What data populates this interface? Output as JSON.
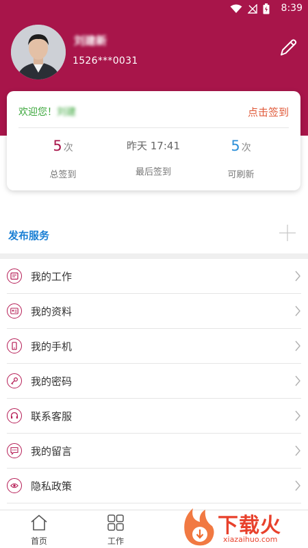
{
  "status_bar": {
    "time": "8:39"
  },
  "profile": {
    "name": "刘建新",
    "phone": "1526***0031"
  },
  "checkin_card": {
    "welcome": "欢迎您！",
    "welcome_name": "刘建",
    "signin_link": "点击签到",
    "total": {
      "value": "5",
      "unit": "次",
      "label": "总签到"
    },
    "last": {
      "value": "昨天 17:41",
      "label": "最后签到"
    },
    "refresh": {
      "value": "5",
      "unit": "次",
      "label": "可刷新"
    }
  },
  "publish": {
    "label": "发布服务"
  },
  "menu": {
    "items": [
      {
        "label": "我的工作",
        "icon": "briefcase-icon"
      },
      {
        "label": "我的资料",
        "icon": "profile-card-icon"
      },
      {
        "label": "我的手机",
        "icon": "phone-icon"
      },
      {
        "label": "我的密码",
        "icon": "key-icon"
      },
      {
        "label": "联系客服",
        "icon": "headset-icon"
      },
      {
        "label": "我的留言",
        "icon": "message-icon"
      },
      {
        "label": "隐私政策",
        "icon": "eye-icon"
      }
    ]
  },
  "bottom_nav": {
    "home": "首页",
    "work": "工作"
  },
  "watermark": {
    "text": "下载火",
    "sub": "xiazaihuo.com"
  },
  "colors": {
    "brand": "#a8154a",
    "accent_blue": "#1a7fd4",
    "welcome_green": "#3aa63a",
    "signin_orange": "#e05a3a"
  }
}
